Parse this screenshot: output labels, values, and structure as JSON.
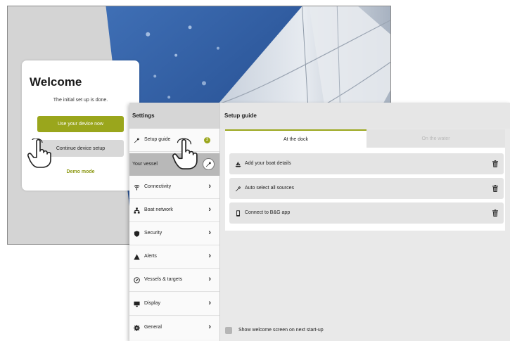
{
  "welcome": {
    "title": "Welcome",
    "subtitle": "The initial set up is done.",
    "use_device_label": "Use your device now",
    "continue_setup_label": "Continue device setup",
    "demo_mode_label": "Demo mode"
  },
  "settings": {
    "sidebar_title": "Settings",
    "setup_guide": {
      "label": "Setup guide",
      "badge": "3",
      "icon": "wrench-icon"
    },
    "your_vessel_label": "Your vessel",
    "nav_items": [
      {
        "label": "Connectivity",
        "icon": "wifi-icon"
      },
      {
        "label": "Boat network",
        "icon": "network-icon"
      },
      {
        "label": "Security",
        "icon": "shield-icon"
      },
      {
        "label": "Alerts",
        "icon": "warning-icon"
      },
      {
        "label": "Vessels & targets",
        "icon": "compass-icon"
      },
      {
        "label": "Display",
        "icon": "display-icon"
      },
      {
        "label": "General",
        "icon": "gear-icon"
      }
    ],
    "main_title": "Setup guide",
    "tabs": [
      {
        "label": "At the dock",
        "active": true
      },
      {
        "label": "On the water",
        "active": false
      }
    ],
    "tasks": [
      {
        "label": "Add your boat details",
        "icon": "sailboat-icon"
      },
      {
        "label": "Auto select all sources",
        "icon": "wrench-icon"
      },
      {
        "label": "Connect to B&G app",
        "icon": "phone-icon"
      }
    ],
    "show_welcome_label": "Show welcome screen on next start-up",
    "show_welcome_checked": false
  },
  "colors": {
    "accent": "#9aa61c",
    "sky": "#2f5fa8"
  }
}
